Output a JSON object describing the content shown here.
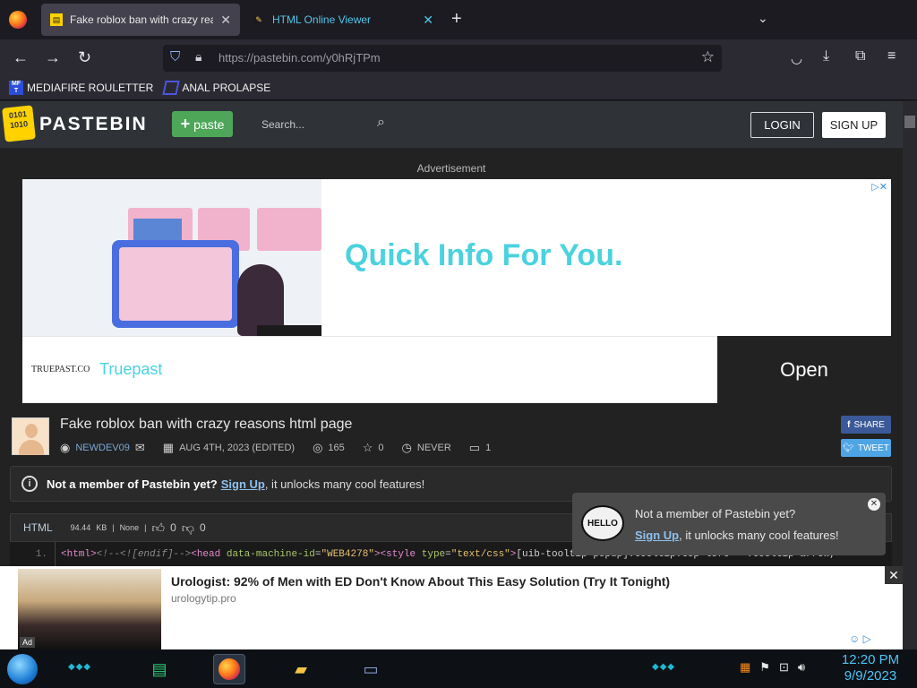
{
  "browser": {
    "tabs": [
      {
        "title": "Fake roblox ban with crazy reasons",
        "active": true,
        "favicon": "pastebin-icon"
      },
      {
        "title": "HTML Online Viewer",
        "active": false,
        "favicon": "pencil-icon"
      }
    ],
    "url_host": "https://pastebin.com/",
    "url_path": "y0hRjTPm",
    "bookmarks": [
      {
        "label": "MEDIAFIRE ROULETTER",
        "icon_text": "MF T"
      },
      {
        "label": "ANAL PROLAPSE",
        "icon_text": ""
      }
    ]
  },
  "pastebin": {
    "logo_text": "PASTEBIN",
    "logo_icon_text": "0101 1010",
    "paste_button": "paste",
    "search_placeholder": "Search...",
    "login": "LOGIN",
    "signup": "SIGN UP"
  },
  "ad_banner": {
    "label": "Advertisement",
    "headline": "Quick Info For You.",
    "brand_small": "TRUEPAST.CO",
    "brand": "Truepast",
    "cta": "Open"
  },
  "paste": {
    "title": "Fake roblox ban with crazy reasons html page",
    "author": "NEWDEV09",
    "date": "AUG 4TH, 2023 (EDITED)",
    "views": "165",
    "stars": "0",
    "expiry": "NEVER",
    "comments": "1",
    "share_label": "SHARE",
    "tweet_label": "TWEET",
    "format": "HTML",
    "size": "94.44",
    "size_unit": "KB",
    "category": "None",
    "likes": "0",
    "dislikes": "0",
    "line_number": "1."
  },
  "notice": {
    "bold": "Not a member of Pastebin yet?",
    "link": "Sign Up",
    "rest": ", it unlocks many cool features!"
  },
  "popup": {
    "icon_text": "HELLO",
    "line1": "Not a member of Pastebin yet?",
    "link": "Sign Up",
    "rest": ", it unlocks many cool features!"
  },
  "bottom_ad": {
    "headline": "Urologist: 92% of Men with ED Don't Know About This Easy Solution (Try It Tonight)",
    "source": "urologytip.pro",
    "badge": "Ad"
  },
  "taskbar": {
    "time": "12:20 PM",
    "date": "9/9/2023"
  },
  "colors": {
    "paste_green": "#4ea659",
    "link_blue": "#8ec0ee",
    "ad_cyan": "#4ad2df"
  }
}
